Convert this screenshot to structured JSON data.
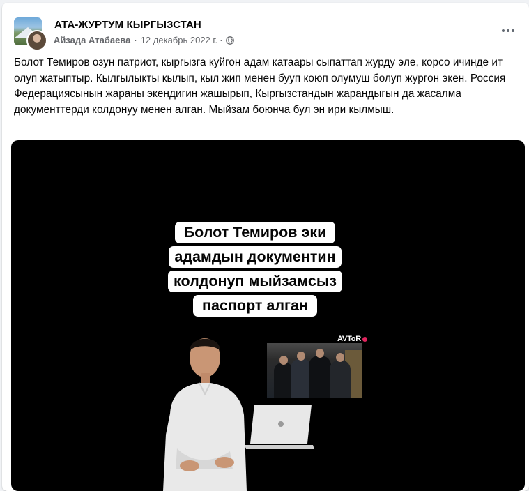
{
  "post": {
    "group_name": "АТА-ЖУРТУМ КЫРГЫЗСТАН",
    "author": "Айзада Атабаева",
    "separator": "·",
    "date": "12 декабрь 2022 г.",
    "separator2": "·",
    "privacy_icon": "globe-icon",
    "more_icon": "more-horizontal-icon",
    "text": "Болот Темиров озун патриот, кыргызга куйгон адам катаары сыпаттап журду эле, корсо ичинде ит олуп жатыптыр. Кылгылыкты кылып, кыл жип менен бууп коюп олумуш болуп жургон экен. Россия Федерациясынын жараны экендигин жашырып, Кыргызстандын жарандыгын да жасалма документтерди колдонуу менен алган. Мыйзам боюнча бул эн ири кылмыш."
  },
  "video": {
    "caption_lines": [
      "Болот Темиров эки",
      "адамдын документин",
      "колдонуп мыйзамсыз",
      "паспорт алган"
    ],
    "brand": "AVToR"
  },
  "colors": {
    "page_bg": "#f0f2f5",
    "card_bg": "#ffffff",
    "meta_text": "#65676b",
    "video_bg": "#000000"
  }
}
